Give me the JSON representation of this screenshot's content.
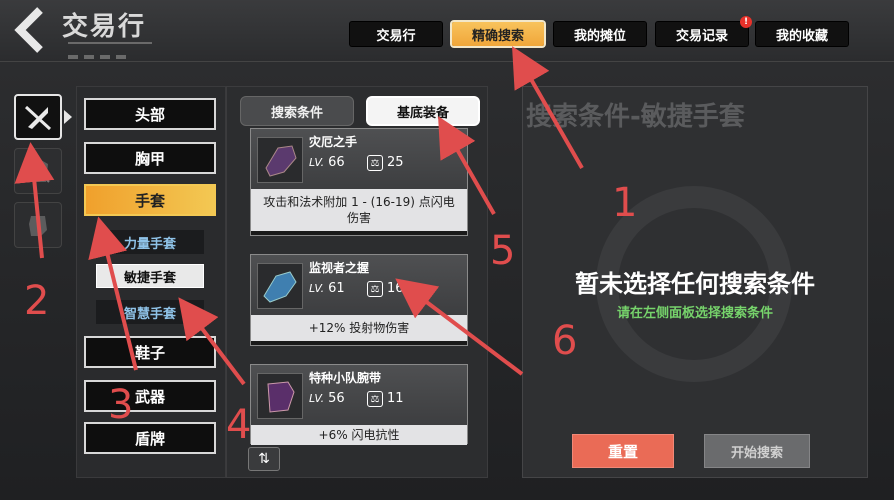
{
  "header": {
    "title": "交易行"
  },
  "tabs": [
    {
      "label": "交易行",
      "active": false
    },
    {
      "label": "精确搜索",
      "active": true
    },
    {
      "label": "我的摊位",
      "active": false
    },
    {
      "label": "交易记录",
      "active": false,
      "badge": "!"
    },
    {
      "label": "我的收藏",
      "active": false
    }
  ],
  "left_rail": [
    {
      "icon": "no-weapon-icon",
      "active": true
    },
    {
      "icon": "armor-icon",
      "active": false
    },
    {
      "icon": "gloves-icon",
      "active": false
    }
  ],
  "categories": [
    {
      "label": "头部",
      "active": false
    },
    {
      "label": "胸甲",
      "active": false
    },
    {
      "label": "手套",
      "active": true
    },
    {
      "label": "鞋子",
      "active": false
    },
    {
      "label": "武器",
      "active": false
    },
    {
      "label": "盾牌",
      "active": false
    }
  ],
  "subcategories": [
    {
      "label": "力量手套",
      "selected": false
    },
    {
      "label": "敏捷手套",
      "selected": true
    },
    {
      "label": "智慧手套",
      "selected": false
    }
  ],
  "middle_tabs": [
    {
      "label": "搜索条件",
      "active": false
    },
    {
      "label": "基底装备",
      "active": true
    }
  ],
  "items": [
    {
      "name": "灾厄之手",
      "lv_label": "LV.",
      "level": "66",
      "weight": "25",
      "desc": "攻击和法术附加 1 - (16-19) 点闪电伤害"
    },
    {
      "name": "监视者之握",
      "lv_label": "LV.",
      "level": "61",
      "weight": "16",
      "desc": "+12% 投射物伤害"
    },
    {
      "name": "特种小队腕带",
      "lv_label": "LV.",
      "level": "56",
      "weight": "11",
      "desc": "+6% 闪电抗性"
    }
  ],
  "right_panel": {
    "title": "搜索条件-敏捷手套",
    "message": "暂未选择任何搜索条件",
    "hint": "请在左侧面板选择搜索条件",
    "reset_label": "重置",
    "search_label": "开始搜索"
  },
  "annotations": [
    "1",
    "2",
    "3",
    "4",
    "5",
    "6"
  ],
  "colors": {
    "accent": "#f0a63a",
    "arrow": "#e04d4d",
    "hint_green": "#76d36b",
    "reset": "#ea6b56"
  }
}
